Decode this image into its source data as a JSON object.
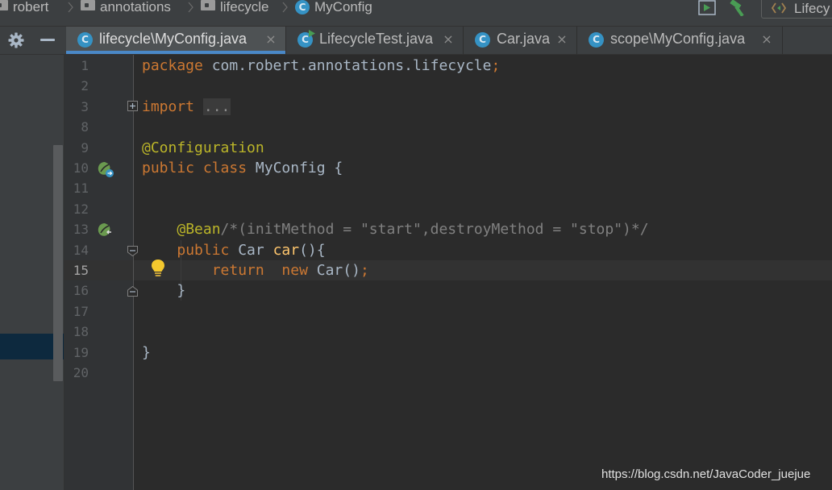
{
  "breadcrumb": {
    "items": [
      {
        "label": "robert",
        "icon": "folder-icon"
      },
      {
        "label": "annotations",
        "icon": "folder-icon"
      },
      {
        "label": "lifecycle",
        "icon": "folder-icon"
      },
      {
        "label": "MyConfig",
        "icon": "class-icon",
        "icon_letter": "C"
      }
    ]
  },
  "toolbar": {
    "run_config_label": "Lifecy"
  },
  "tabs": [
    {
      "label": "lifecycle\\MyConfig.java",
      "icon_letter": "C",
      "active": true
    },
    {
      "label": "LifecycleTest.java",
      "icon_letter": "C",
      "active": false,
      "runnable": true
    },
    {
      "label": "Car.java",
      "icon_letter": "C",
      "active": false
    },
    {
      "label": "scope\\MyConfig.java",
      "icon_letter": "C",
      "active": false
    }
  ],
  "close_glyph": "×",
  "editor": {
    "current_line": 15,
    "lines": [
      {
        "n": "1",
        "tokens": [
          {
            "t": "package ",
            "c": "kw"
          },
          {
            "t": "com.robert.annotations.lifecycle",
            "c": ""
          },
          {
            "t": ";",
            "c": "kw"
          }
        ]
      },
      {
        "n": "2",
        "tokens": []
      },
      {
        "n": "3",
        "tokens": [
          {
            "t": "import ",
            "c": "kw"
          },
          {
            "t": "...",
            "c": "fold-box"
          }
        ]
      },
      {
        "n": "8",
        "tokens": []
      },
      {
        "n": "9",
        "tokens": [
          {
            "t": "@Configuration",
            "c": "ann"
          }
        ]
      },
      {
        "n": "10",
        "tokens": [
          {
            "t": "public class ",
            "c": "kw"
          },
          {
            "t": "MyConfig {",
            "c": ""
          }
        ]
      },
      {
        "n": "11",
        "tokens": []
      },
      {
        "n": "12",
        "tokens": []
      },
      {
        "n": "13",
        "tokens": [
          {
            "t": "    ",
            "c": ""
          },
          {
            "t": "@Bean",
            "c": "ann"
          },
          {
            "t": "/*(initMethod = \"start\",destroyMethod = \"stop\")*/",
            "c": "cmt"
          }
        ]
      },
      {
        "n": "14",
        "tokens": [
          {
            "t": "    ",
            "c": ""
          },
          {
            "t": "public ",
            "c": "kw"
          },
          {
            "t": "Car ",
            "c": ""
          },
          {
            "t": "car",
            "c": "fn"
          },
          {
            "t": "(){",
            "c": ""
          }
        ]
      },
      {
        "n": "15",
        "tokens": [
          {
            "t": "        ",
            "c": ""
          },
          {
            "t": "return  new ",
            "c": "kw"
          },
          {
            "t": "Car()",
            "c": ""
          },
          {
            "t": ";",
            "c": "kw"
          }
        ]
      },
      {
        "n": "16",
        "tokens": [
          {
            "t": "    ",
            "c": ""
          },
          {
            "t": "}",
            "c": ""
          }
        ]
      },
      {
        "n": "17",
        "tokens": []
      },
      {
        "n": "18",
        "tokens": []
      },
      {
        "n": "19",
        "tokens": [
          {
            "t": "}",
            "c": ""
          }
        ]
      },
      {
        "n": "20",
        "tokens": []
      }
    ]
  },
  "watermark": "https://blog.csdn.net/JavaCoder_juejue",
  "colors": {
    "keyword": "#cc7832",
    "annotation": "#bbb529",
    "comment": "#808080",
    "method": "#ffc66d",
    "text": "#a9b7c6",
    "class_icon": "#3592c4",
    "active_tab_underline": "#4a88c7"
  }
}
